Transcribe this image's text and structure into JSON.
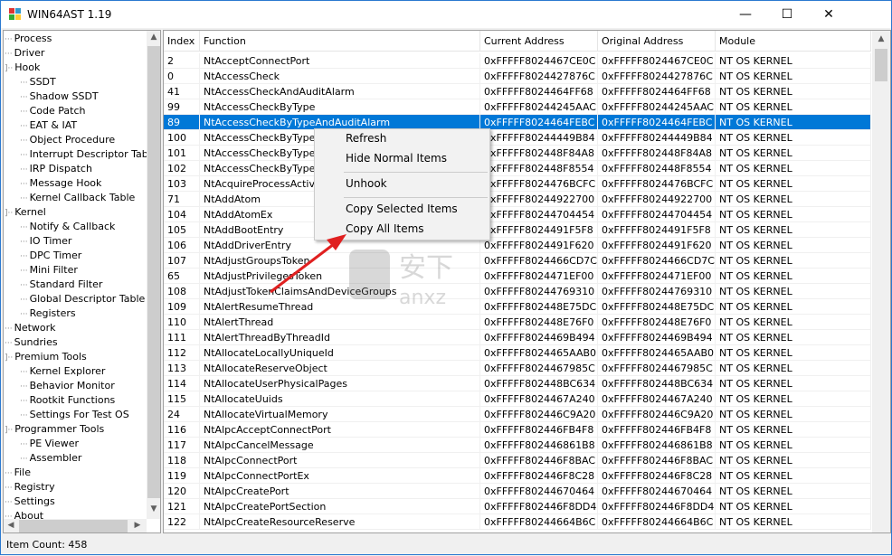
{
  "window": {
    "title": "WIN64AST 1.19",
    "minimize": "—",
    "maximize": "☐",
    "close": "✕"
  },
  "tree": [
    {
      "label": "Process",
      "level": 0
    },
    {
      "label": "Driver",
      "level": 0
    },
    {
      "label": "Hook",
      "level": 0,
      "expanded": true
    },
    {
      "label": "SSDT",
      "level": 1
    },
    {
      "label": "Shadow SSDT",
      "level": 1
    },
    {
      "label": "Code Patch",
      "level": 1
    },
    {
      "label": "EAT & IAT",
      "level": 1
    },
    {
      "label": "Object Procedure",
      "level": 1
    },
    {
      "label": "Interrupt Descriptor Table",
      "level": 1
    },
    {
      "label": "IRP Dispatch",
      "level": 1
    },
    {
      "label": "Message Hook",
      "level": 1
    },
    {
      "label": "Kernel Callback Table",
      "level": 1
    },
    {
      "label": "Kernel",
      "level": 0,
      "expanded": true
    },
    {
      "label": "Notify & Callback",
      "level": 1
    },
    {
      "label": "IO Timer",
      "level": 1
    },
    {
      "label": "DPC Timer",
      "level": 1
    },
    {
      "label": "Mini Filter",
      "level": 1
    },
    {
      "label": "Standard Filter",
      "level": 1
    },
    {
      "label": "Global Descriptor Table",
      "level": 1
    },
    {
      "label": "Registers",
      "level": 1
    },
    {
      "label": "Network",
      "level": 0
    },
    {
      "label": "Sundries",
      "level": 0
    },
    {
      "label": "Premium Tools",
      "level": 0,
      "expanded": true
    },
    {
      "label": "Kernel Explorer",
      "level": 1
    },
    {
      "label": "Behavior Monitor",
      "level": 1
    },
    {
      "label": "Rootkit Functions",
      "level": 1
    },
    {
      "label": "Settings For Test OS",
      "level": 1
    },
    {
      "label": "Programmer Tools",
      "level": 0,
      "expanded": true
    },
    {
      "label": "PE Viewer",
      "level": 1
    },
    {
      "label": "Assembler",
      "level": 1
    },
    {
      "label": "File",
      "level": 0
    },
    {
      "label": "Registry",
      "level": 0
    },
    {
      "label": "Settings",
      "level": 0
    },
    {
      "label": "About",
      "level": 0
    }
  ],
  "table": {
    "columns": [
      "Index",
      "Function",
      "Current Address",
      "Original Address",
      "Module"
    ],
    "selected_index": 4,
    "rows": [
      [
        "2",
        "NtAcceptConnectPort",
        "0xFFFFF8024467CE0C",
        "0xFFFFF8024467CE0C",
        "NT OS KERNEL"
      ],
      [
        "0",
        "NtAccessCheck",
        "0xFFFFF8024427876C",
        "0xFFFFF8024427876C",
        "NT OS KERNEL"
      ],
      [
        "41",
        "NtAccessCheckAndAuditAlarm",
        "0xFFFFF8024464FF68",
        "0xFFFFF8024464FF68",
        "NT OS KERNEL"
      ],
      [
        "99",
        "NtAccessCheckByType",
        "0xFFFFF80244245AAC",
        "0xFFFFF80244245AAC",
        "NT OS KERNEL"
      ],
      [
        "89",
        "NtAccessCheckByTypeAndAuditAlarm",
        "0xFFFFF8024464FEBC",
        "0xFFFFF8024464FEBC",
        "NT OS KERNEL"
      ],
      [
        "100",
        "NtAccessCheckByTypeRe",
        "0xFFFFF80244449B84",
        "0xFFFFF80244449B84",
        "NT OS KERNEL"
      ],
      [
        "101",
        "NtAccessCheckByTypeRe",
        "0xFFFFF802448F84A8",
        "0xFFFFF802448F84A8",
        "NT OS KERNEL"
      ],
      [
        "102",
        "NtAccessCheckByTypeRe",
        "0xFFFFF802448F8554",
        "0xFFFFF802448F8554",
        "NT OS KERNEL"
      ],
      [
        "103",
        "NtAcquireProcessActivity",
        "0xFFFFF8024476BCFC",
        "0xFFFFF8024476BCFC",
        "NT OS KERNEL"
      ],
      [
        "71",
        "NtAddAtom",
        "0xFFFFF80244922700",
        "0xFFFFF80244922700",
        "NT OS KERNEL"
      ],
      [
        "104",
        "NtAddAtomEx",
        "0xFFFFF80244704454",
        "0xFFFFF80244704454",
        "NT OS KERNEL"
      ],
      [
        "105",
        "NtAddBootEntry",
        "0xFFFFF8024491F5F8",
        "0xFFFFF8024491F5F8",
        "NT OS KERNEL"
      ],
      [
        "106",
        "NtAddDriverEntry",
        "0xFFFFF8024491F620",
        "0xFFFFF8024491F620",
        "NT OS KERNEL"
      ],
      [
        "107",
        "NtAdjustGroupsToken",
        "0xFFFFF8024466CD7C",
        "0xFFFFF8024466CD7C",
        "NT OS KERNEL"
      ],
      [
        "65",
        "NtAdjustPrivilegesToken",
        "0xFFFFF8024471EF00",
        "0xFFFFF8024471EF00",
        "NT OS KERNEL"
      ],
      [
        "108",
        "NtAdjustTokenClaimsAndDeviceGroups",
        "0xFFFFF80244769310",
        "0xFFFFF80244769310",
        "NT OS KERNEL"
      ],
      [
        "109",
        "NtAlertResumeThread",
        "0xFFFFF802448E75DC",
        "0xFFFFF802448E75DC",
        "NT OS KERNEL"
      ],
      [
        "110",
        "NtAlertThread",
        "0xFFFFF802448E76F0",
        "0xFFFFF802448E76F0",
        "NT OS KERNEL"
      ],
      [
        "111",
        "NtAlertThreadByThreadId",
        "0xFFFFF8024469B494",
        "0xFFFFF8024469B494",
        "NT OS KERNEL"
      ],
      [
        "112",
        "NtAllocateLocallyUniqueId",
        "0xFFFFF8024465AAB0",
        "0xFFFFF8024465AAB0",
        "NT OS KERNEL"
      ],
      [
        "113",
        "NtAllocateReserveObject",
        "0xFFFFF8024467985C",
        "0xFFFFF8024467985C",
        "NT OS KERNEL"
      ],
      [
        "114",
        "NtAllocateUserPhysicalPages",
        "0xFFFFF802448BC634",
        "0xFFFFF802448BC634",
        "NT OS KERNEL"
      ],
      [
        "115",
        "NtAllocateUuids",
        "0xFFFFF8024467A240",
        "0xFFFFF8024467A240",
        "NT OS KERNEL"
      ],
      [
        "24",
        "NtAllocateVirtualMemory",
        "0xFFFFF802446C9A20",
        "0xFFFFF802446C9A20",
        "NT OS KERNEL"
      ],
      [
        "116",
        "NtAlpcAcceptConnectPort",
        "0xFFFFF802446FB4F8",
        "0xFFFFF802446FB4F8",
        "NT OS KERNEL"
      ],
      [
        "117",
        "NtAlpcCancelMessage",
        "0xFFFFF802446861B8",
        "0xFFFFF802446861B8",
        "NT OS KERNEL"
      ],
      [
        "118",
        "NtAlpcConnectPort",
        "0xFFFFF802446F8BAC",
        "0xFFFFF802446F8BAC",
        "NT OS KERNEL"
      ],
      [
        "119",
        "NtAlpcConnectPortEx",
        "0xFFFFF802446F8C28",
        "0xFFFFF802446F8C28",
        "NT OS KERNEL"
      ],
      [
        "120",
        "NtAlpcCreatePort",
        "0xFFFFF80244670464",
        "0xFFFFF80244670464",
        "NT OS KERNEL"
      ],
      [
        "121",
        "NtAlpcCreatePortSection",
        "0xFFFFF802446F8DD4",
        "0xFFFFF802446F8DD4",
        "NT OS KERNEL"
      ],
      [
        "122",
        "NtAlpcCreateResourceReserve",
        "0xFFFFF80244664B6C",
        "0xFFFFF80244664B6C",
        "NT OS KERNEL"
      ]
    ]
  },
  "context_menu": {
    "items": [
      "Refresh",
      "Hide Normal Items",
      "Unhook",
      "Copy Selected Items",
      "Copy All Items"
    ]
  },
  "status": {
    "item_count": "Item Count: 458"
  },
  "colors": {
    "selection": "#0078d7",
    "annotation_arrow": "#e02020"
  }
}
